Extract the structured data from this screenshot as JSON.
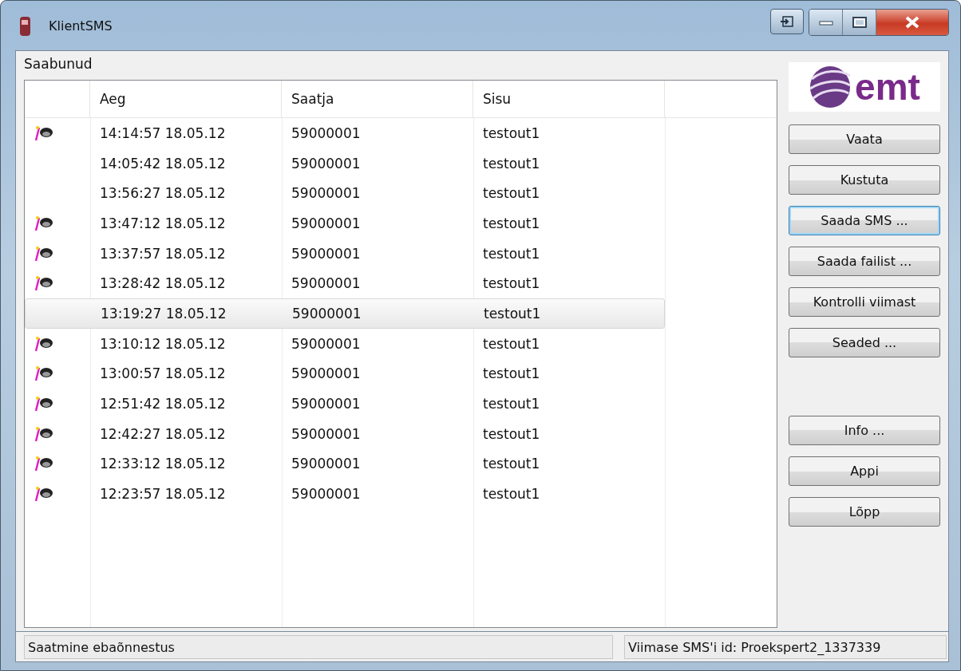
{
  "window": {
    "title": "KlientSMS"
  },
  "group_label": "Saabunud",
  "logo": {
    "text": "emt"
  },
  "table": {
    "columns": [
      "Aeg",
      "Saatja",
      "Sisu"
    ],
    "rows": [
      {
        "unread": true,
        "selected": false,
        "cells": [
          "14:14:57 18.05.12",
          "59000001",
          "testout1"
        ]
      },
      {
        "unread": false,
        "selected": false,
        "cells": [
          "14:05:42 18.05.12",
          "59000001",
          "testout1"
        ]
      },
      {
        "unread": false,
        "selected": false,
        "cells": [
          "13:56:27 18.05.12",
          "59000001",
          "testout1"
        ]
      },
      {
        "unread": true,
        "selected": false,
        "cells": [
          "13:47:12 18.05.12",
          "59000001",
          "testout1"
        ]
      },
      {
        "unread": true,
        "selected": false,
        "cells": [
          "13:37:57 18.05.12",
          "59000001",
          "testout1"
        ]
      },
      {
        "unread": true,
        "selected": false,
        "cells": [
          "13:28:42 18.05.12",
          "59000001",
          "testout1"
        ]
      },
      {
        "unread": false,
        "selected": true,
        "cells": [
          "13:19:27 18.05.12",
          "59000001",
          "testout1"
        ]
      },
      {
        "unread": true,
        "selected": false,
        "cells": [
          "13:10:12 18.05.12",
          "59000001",
          "testout1"
        ]
      },
      {
        "unread": true,
        "selected": false,
        "cells": [
          "13:00:57 18.05.12",
          "59000001",
          "testout1"
        ]
      },
      {
        "unread": true,
        "selected": false,
        "cells": [
          "12:51:42 18.05.12",
          "59000001",
          "testout1"
        ]
      },
      {
        "unread": true,
        "selected": false,
        "cells": [
          "12:42:27 18.05.12",
          "59000001",
          "testout1"
        ]
      },
      {
        "unread": true,
        "selected": false,
        "cells": [
          "12:33:12 18.05.12",
          "59000001",
          "testout1"
        ]
      },
      {
        "unread": true,
        "selected": false,
        "cells": [
          "12:23:57 18.05.12",
          "59000001",
          "testout1"
        ]
      }
    ]
  },
  "buttons": [
    {
      "label": "Vaata",
      "focused": false,
      "gap_before": false
    },
    {
      "label": "Kustuta",
      "focused": false,
      "gap_before": false
    },
    {
      "label": "Saada SMS ...",
      "focused": true,
      "gap_before": false
    },
    {
      "label": "Saada failist ...",
      "focused": false,
      "gap_before": false
    },
    {
      "label": "Kontrolli viimast",
      "focused": false,
      "gap_before": false
    },
    {
      "label": "Seaded ...",
      "focused": false,
      "gap_before": false
    },
    {
      "label": "Info ...",
      "focused": false,
      "gap_before": true
    },
    {
      "label": "Appi",
      "focused": false,
      "gap_before": false
    },
    {
      "label": "Lõpp",
      "focused": false,
      "gap_before": false
    }
  ],
  "status_bar": {
    "message": "Saatmine ebaõnnestus",
    "last_id": "Viimase SMS'i id: Proekspert2_1337339"
  }
}
